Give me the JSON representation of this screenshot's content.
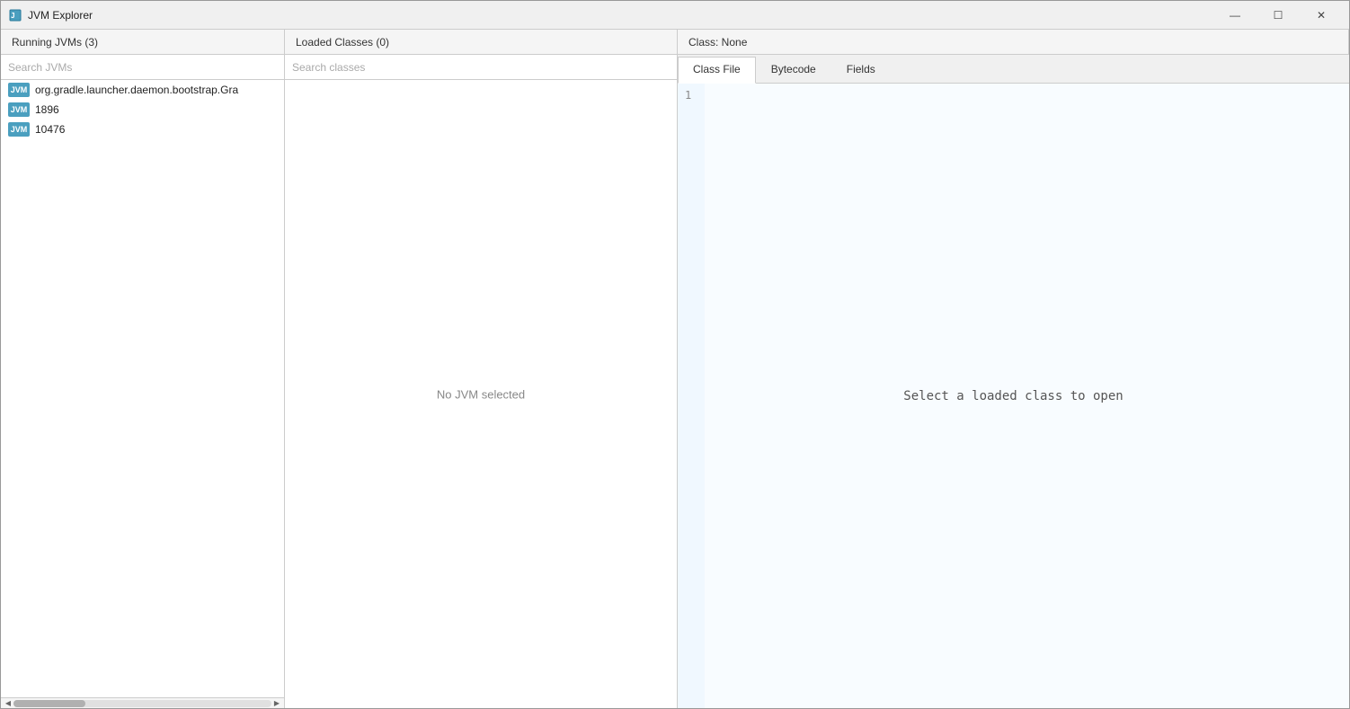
{
  "window": {
    "title": "JVM Explorer",
    "icon": "jvm-icon"
  },
  "titlebar": {
    "minimize_label": "—",
    "maximize_label": "☐",
    "close_label": "✕"
  },
  "sections": {
    "jvm_panel": {
      "header": "Running JVMs (3)",
      "search_placeholder": "Search JVMs"
    },
    "classes_panel": {
      "header": "Loaded Classes (0)",
      "search_placeholder": "Search classes",
      "empty_message": "No JVM selected"
    },
    "class_view_panel": {
      "header": "Class: None"
    }
  },
  "tabs": [
    {
      "label": "Class File",
      "active": true
    },
    {
      "label": "Bytecode",
      "active": false
    },
    {
      "label": "Fields",
      "active": false
    }
  ],
  "jvm_list": [
    {
      "id": "jvm1",
      "badge": "JVM",
      "name": "org.gradle.launcher.daemon.bootstrap.Gra"
    },
    {
      "id": "jvm2",
      "badge": "JVM",
      "name": "1896"
    },
    {
      "id": "jvm3",
      "badge": "JVM",
      "name": "10476"
    }
  ],
  "code_view": {
    "line_number": "1",
    "empty_message": "Select a loaded class to open"
  }
}
